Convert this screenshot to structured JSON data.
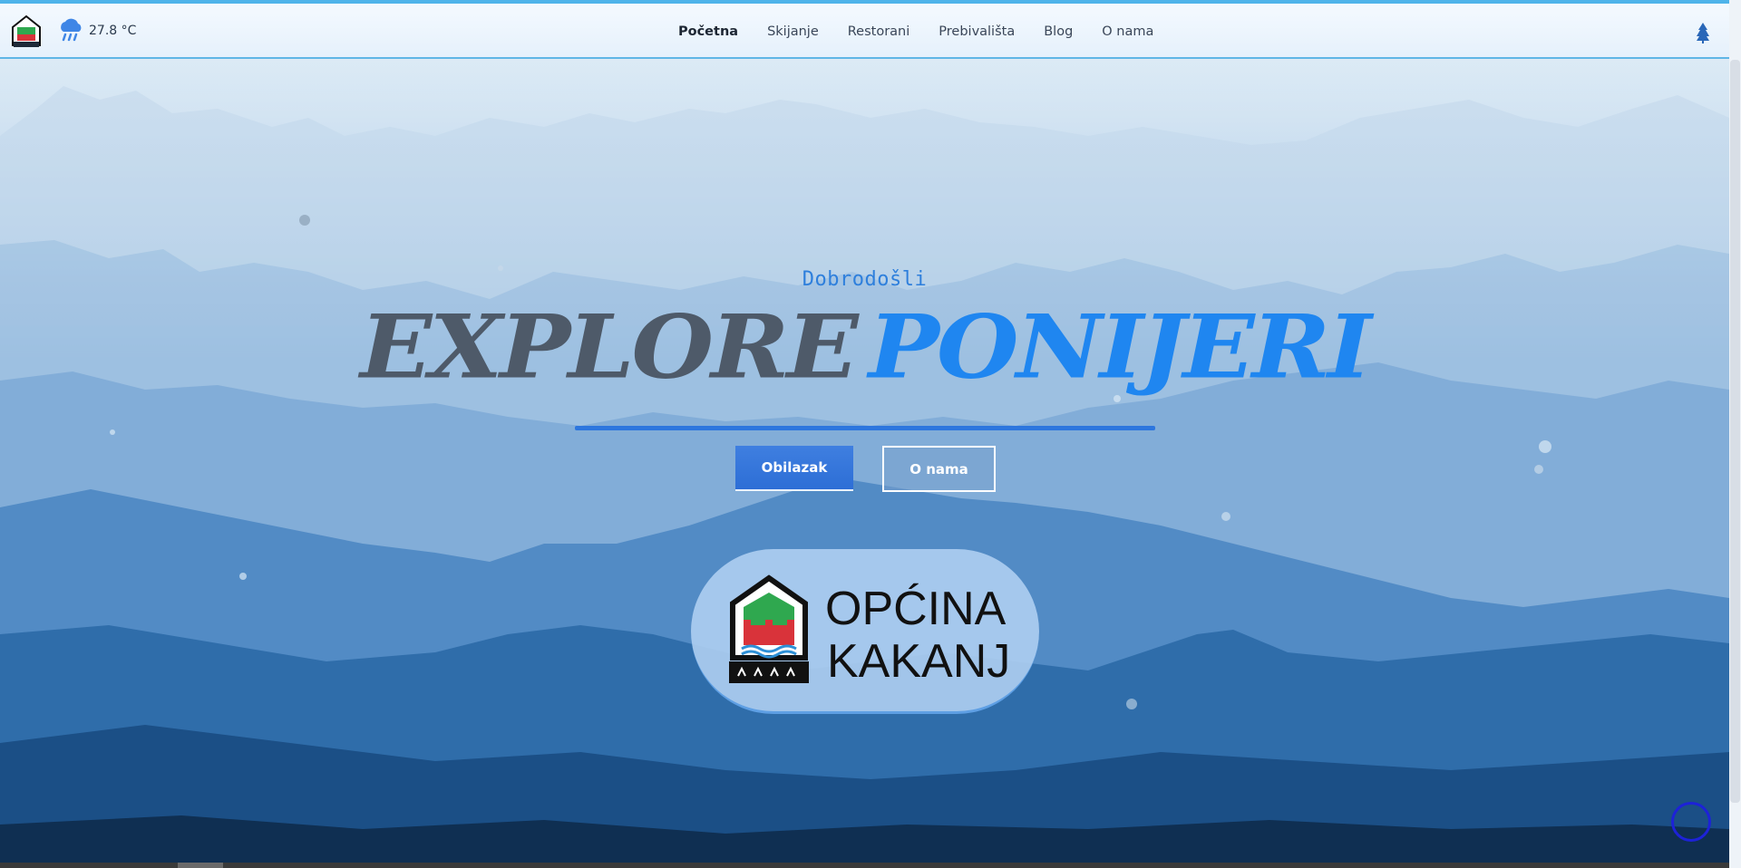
{
  "navbar": {
    "weather_temp": "27.8 °C",
    "items": [
      {
        "label": "Početna",
        "active": true
      },
      {
        "label": "Skijanje"
      },
      {
        "label": "Restorani"
      },
      {
        "label": "Prebivališta"
      },
      {
        "label": "Blog"
      },
      {
        "label": "O nama"
      }
    ]
  },
  "hero": {
    "welcome": "Dobrodošli",
    "title_part1": "EXPLORE",
    "title_part2": "PONIJERI",
    "primary_button": "Obilazak",
    "secondary_button": "O nama"
  },
  "badge": {
    "line1": "OPĆINA",
    "line2": "KAKANJ"
  },
  "colors": {
    "accent": "#2d76de",
    "title_dark": "#4e5a69",
    "title_blue": "#1f86f0"
  },
  "icons": {
    "weather": "cloud-rain-icon",
    "tree": "pine-tree-icon",
    "logo": "ponijeri-logo",
    "crest": "kakanj-crest"
  }
}
